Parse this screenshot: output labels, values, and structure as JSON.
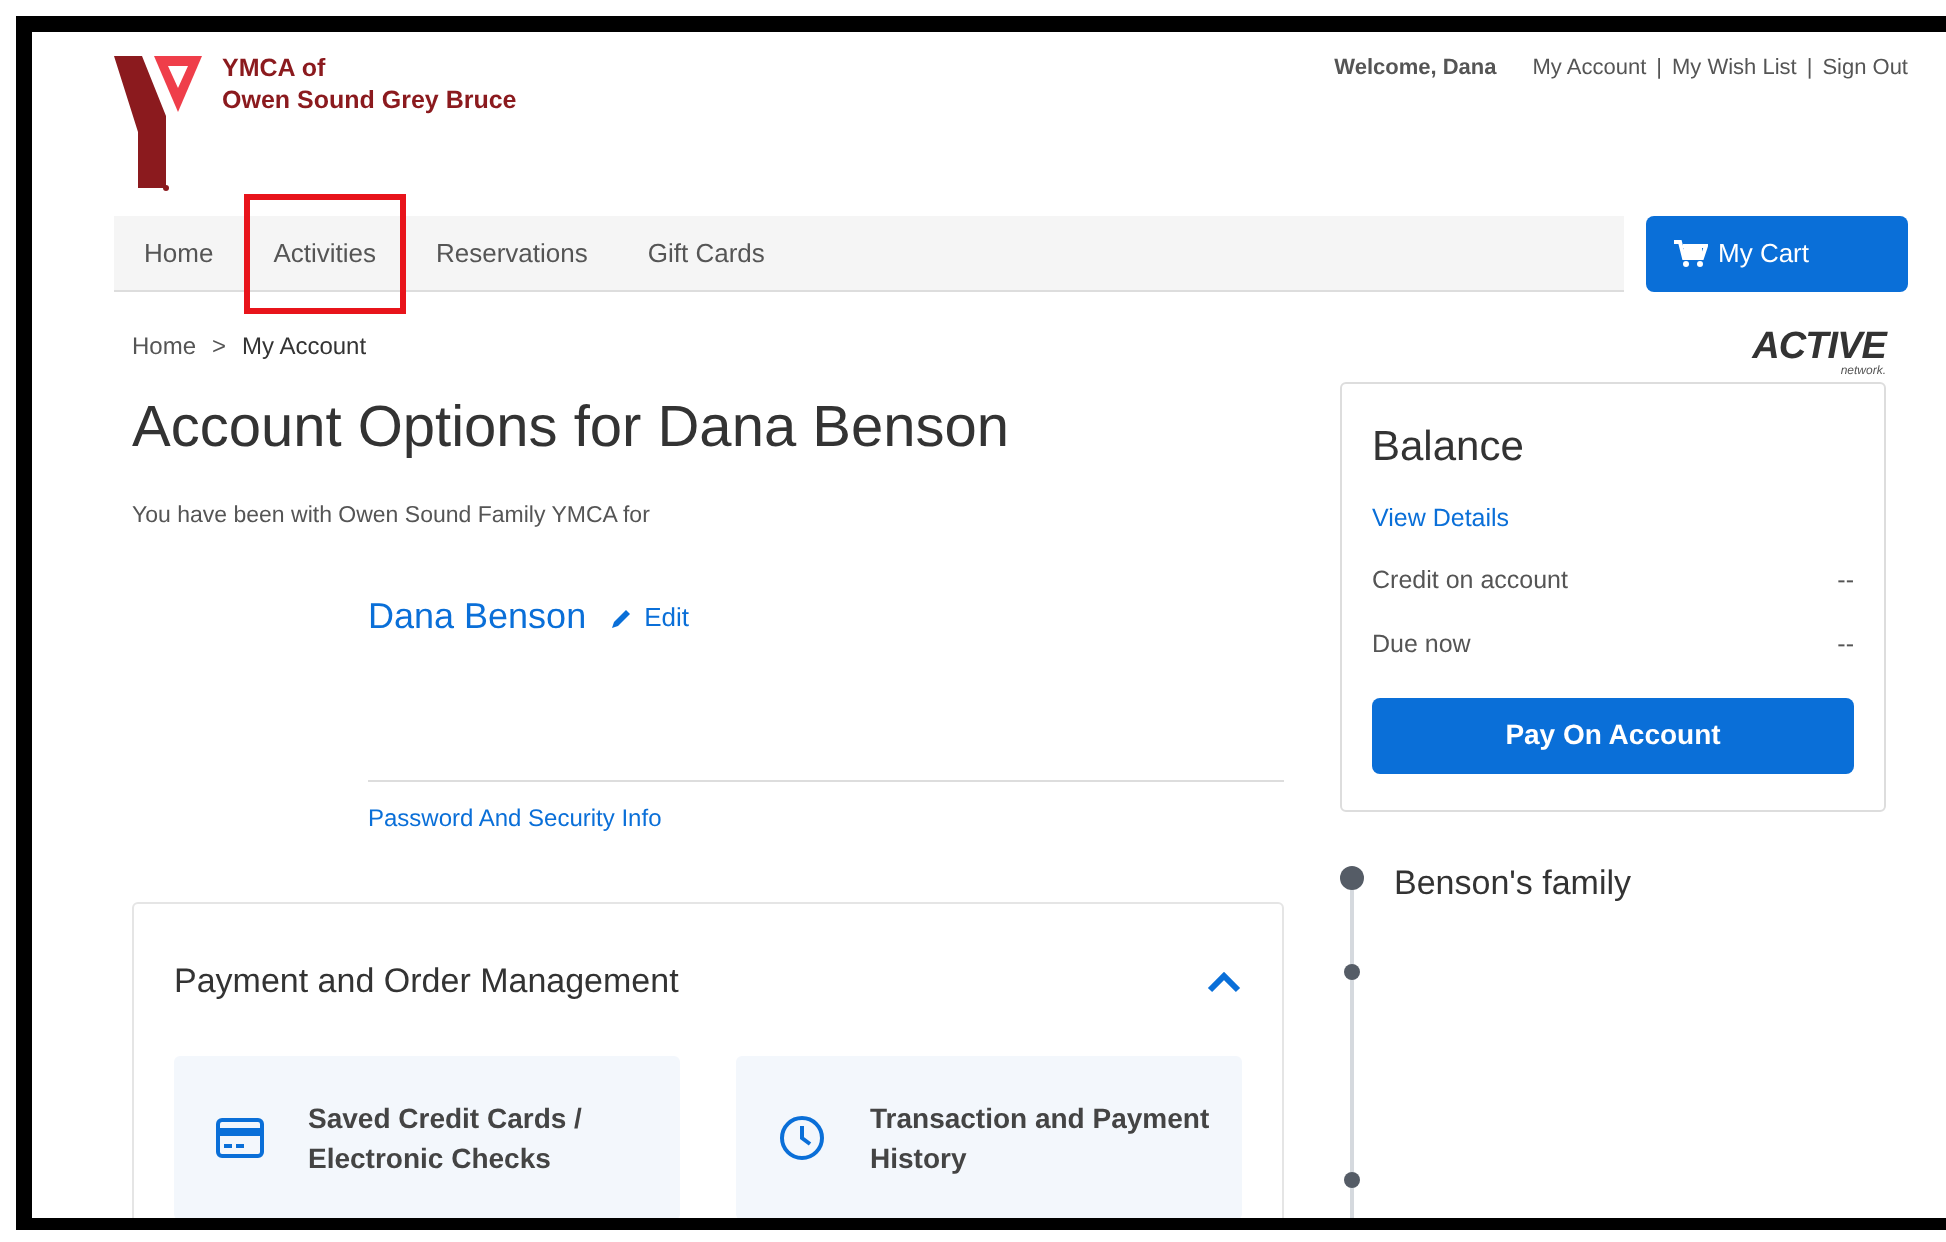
{
  "logo": {
    "line1": "YMCA of",
    "line2": "Owen Sound Grey Bruce"
  },
  "top_links": {
    "welcome": "Welcome, Dana",
    "links": [
      {
        "label": "My Account"
      },
      {
        "separator": "|",
        "label": "My Wish List"
      },
      {
        "separator": "|",
        "label": "Sign Out"
      }
    ]
  },
  "nav": [
    {
      "label": "Home",
      "highlighted": false
    },
    {
      "label": "Activities",
      "highlighted": true
    },
    {
      "label": "Reservations",
      "highlighted": false
    },
    {
      "label": "Gift Cards",
      "highlighted": false
    }
  ],
  "cart": {
    "label": "My Cart"
  },
  "brand": {
    "name": "ACTIVE",
    "sub": "network."
  },
  "breadcrumb": [
    {
      "label": "Home"
    },
    {
      "separator": ">",
      "label": "My Account"
    }
  ],
  "heading": "Account Options for Dana Benson",
  "membership_note": "You have been with Owen Sound Family YMCA for",
  "profile": {
    "name": "Dana Benson",
    "edit": "Edit",
    "security_link": "Password And Security Info"
  },
  "section": {
    "title": "Payment and Order Management",
    "expanded": true,
    "cards": [
      {
        "kind": "card",
        "label": "Saved Credit Cards / Electronic Checks"
      },
      {
        "kind": "clock",
        "label": "Transaction and Payment History"
      }
    ]
  },
  "balance": {
    "title": "Balance",
    "details_link": "View Details",
    "rows": [
      {
        "label": "Credit on account",
        "value": "--"
      },
      {
        "label": "Due now",
        "value": "--"
      }
    ],
    "button": "Pay On Account"
  },
  "family": {
    "title": "Benson's family"
  }
}
